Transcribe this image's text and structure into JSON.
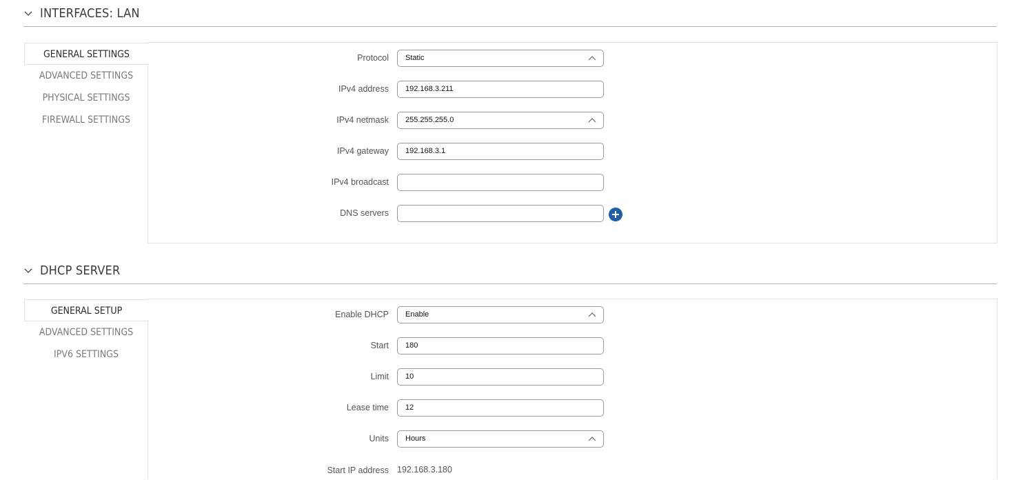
{
  "sections": {
    "lan": {
      "title": "INTERFACES: LAN",
      "tabs": [
        "GENERAL SETTINGS",
        "ADVANCED SETTINGS",
        "PHYSICAL SETTINGS",
        "FIREWALL SETTINGS"
      ],
      "fields": {
        "protocol": {
          "label": "Protocol",
          "value": "Static"
        },
        "ipv4_address": {
          "label": "IPv4 address",
          "value": "192.168.3.211"
        },
        "ipv4_netmask": {
          "label": "IPv4 netmask",
          "value": "255.255.255.0"
        },
        "ipv4_gateway": {
          "label": "IPv4 gateway",
          "value": "192.168.3.1"
        },
        "ipv4_broadcast": {
          "label": "IPv4 broadcast",
          "value": ""
        },
        "dns_servers": {
          "label": "DNS servers",
          "value": ""
        }
      }
    },
    "dhcp": {
      "title": "DHCP SERVER",
      "tabs": [
        "GENERAL SETUP",
        "ADVANCED SETTINGS",
        "IPV6 SETTINGS"
      ],
      "fields": {
        "enable_dhcp": {
          "label": "Enable DHCP",
          "value": "Enable"
        },
        "start": {
          "label": "Start",
          "value": "180"
        },
        "limit": {
          "label": "Limit",
          "value": "10"
        },
        "lease_time": {
          "label": "Lease time",
          "value": "12"
        },
        "units": {
          "label": "Units",
          "value": "Hours"
        },
        "start_ip": {
          "label": "Start IP address",
          "value": "192.168.3.180"
        }
      }
    }
  },
  "icons": {
    "collapse": "chevron-down-icon",
    "dropdown": "chevron-up-icon",
    "add": "plus-icon"
  },
  "colors": {
    "accent": "#1f5fa6"
  }
}
